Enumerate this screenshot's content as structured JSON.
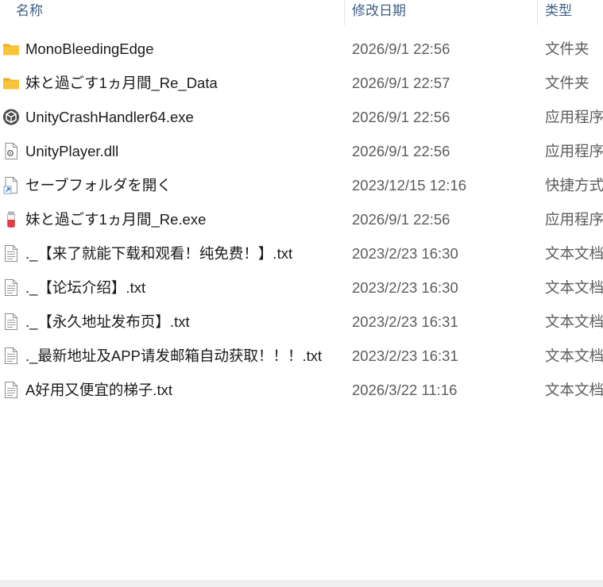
{
  "header": {
    "name_label": "名称",
    "date_label": "修改日期",
    "type_label": "类型"
  },
  "files": [
    {
      "name": "MonoBleedingEdge",
      "date": "2026/9/1 22:56",
      "type": "文件夹",
      "icon": "folder-icon"
    },
    {
      "name": "妹と過ごす1ヵ月間_Re_Data",
      "date": "2026/9/1 22:57",
      "type": "文件夹",
      "icon": "folder-icon"
    },
    {
      "name": "UnityCrashHandler64.exe",
      "date": "2026/9/1 22:56",
      "type": "应用程序",
      "icon": "unity-app-icon"
    },
    {
      "name": "UnityPlayer.dll",
      "date": "2026/9/1 22:56",
      "type": "应用程序",
      "icon": "dll-file-icon"
    },
    {
      "name": "セーブフォルダを開く",
      "date": "2023/12/15 12:16",
      "type": "快捷方式",
      "icon": "shortcut-icon"
    },
    {
      "name": "妹と過ごす1ヵ月間_Re.exe",
      "date": "2026/9/1 22:56",
      "type": "应用程序",
      "icon": "game-exe-icon"
    },
    {
      "name": "._【来了就能下载和观看！纯免费！】.txt",
      "date": "2023/2/23 16:30",
      "type": "文本文档",
      "icon": "text-file-icon"
    },
    {
      "name": "._【论坛介绍】.txt",
      "date": "2023/2/23 16:30",
      "type": "文本文档",
      "icon": "text-file-icon"
    },
    {
      "name": "._【永久地址发布页】.txt",
      "date": "2023/2/23 16:31",
      "type": "文本文档",
      "icon": "text-file-icon"
    },
    {
      "name": "._最新地址及APP请发邮箱自动获取！！！.txt",
      "date": "2023/2/23 16:31",
      "type": "文本文档",
      "icon": "text-file-icon"
    },
    {
      "name": "A好用又便宜的梯子.txt",
      "date": "2026/3/22 11:16",
      "type": "文本文档",
      "icon": "text-file-icon"
    }
  ],
  "colors": {
    "header_text": "#3f5f86",
    "secondary_text": "#5c5c5c",
    "folder_yellow": "#f8c53a",
    "shortcut_arrow": "#2a7ad8"
  }
}
